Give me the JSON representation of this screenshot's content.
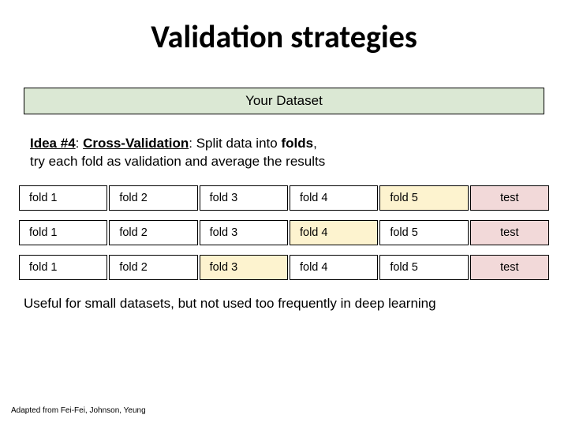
{
  "title": "Validation strategies",
  "dataset_label": "Your Dataset",
  "idea": {
    "label": "Idea #4",
    "name": "Cross-Validation",
    "desc_a": "Split data into ",
    "desc_bold": "folds",
    "desc_b": ",",
    "desc_line2": "try each fold as validation and average the results"
  },
  "folds": {
    "labels": [
      "fold 1",
      "fold 2",
      "fold 3",
      "fold 4",
      "fold 5"
    ],
    "test_label": "test",
    "highlight_index_by_row": [
      4,
      3,
      2
    ]
  },
  "note": "Useful for small datasets, but not used too frequently in deep learning",
  "credit": "Adapted from Fei-Fei, Johnson, Yeung"
}
